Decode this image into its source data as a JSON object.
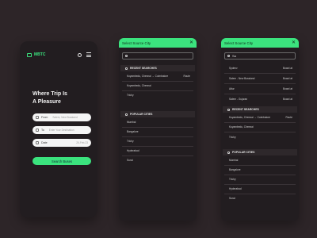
{
  "home": {
    "logo": "MBTC",
    "hero_line1": "Where Trip Is",
    "hero_line2": "A Pleasure",
    "from_label": "From",
    "from_value": "Salem, New Busstand",
    "to_label": "To",
    "to_placeholder": "Enter Your Destination",
    "date_label": "Date",
    "date_value": "26-Feb-23",
    "search_button": "Search Buses"
  },
  "select_panel": {
    "title": "Select Source City",
    "close": "✕",
    "search_value_2": "",
    "search_value_3": "Sa",
    "recent_title": "RECENT SEARCHES",
    "popular_title": "POPULAR CITIES",
    "recent": [
      {
        "route": "Koyambedu, Chennai → Coimbatore",
        "tag": "Route"
      },
      {
        "route": "Koyambedu, Chennai",
        "tag": ""
      },
      {
        "route": "Trichy",
        "tag": ""
      }
    ],
    "popular": [
      "Mumbai",
      "Bangalore",
      "Trichy",
      "Hyderabad",
      "Surat"
    ],
    "results": [
      {
        "name": "Sydenv",
        "tag": "Board at"
      },
      {
        "name": "Salem - New Busstand",
        "tag": "Board at"
      },
      {
        "name": "Attur",
        "tag": "Board at"
      },
      {
        "name": "Salem - Gujaran",
        "tag": "Board at"
      }
    ]
  }
}
